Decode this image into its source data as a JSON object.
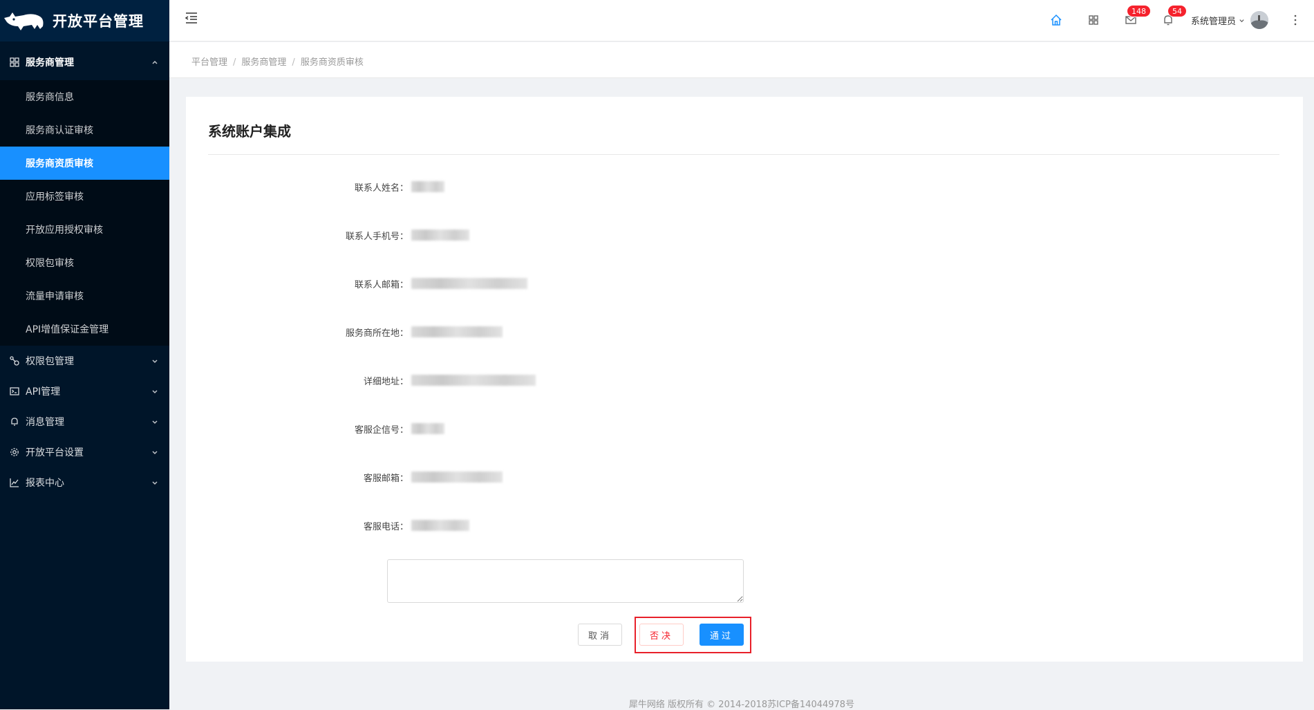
{
  "app": {
    "title": "开放平台管理"
  },
  "sidebar": {
    "groups": [
      {
        "label": "服务商管理",
        "icon": "appstore-icon",
        "expanded": true,
        "items": [
          {
            "label": "服务商信息"
          },
          {
            "label": "服务商认证审核"
          },
          {
            "label": "服务商资质审核",
            "active": true
          },
          {
            "label": "应用标签审核"
          },
          {
            "label": "开放应用授权审核"
          },
          {
            "label": "权限包审核"
          },
          {
            "label": "流量申请审核"
          },
          {
            "label": "API增值保证金管理"
          }
        ]
      },
      {
        "label": "权限包管理",
        "icon": "share-node-icon"
      },
      {
        "label": "API管理",
        "icon": "terminal-icon"
      },
      {
        "label": "消息管理",
        "icon": "bell-icon"
      },
      {
        "label": "开放平台设置",
        "icon": "gear-icon"
      },
      {
        "label": "报表中心",
        "icon": "line-chart-icon"
      }
    ]
  },
  "header": {
    "messages_count": "148",
    "notifications_count": "54",
    "user_name": "系统管理员",
    "accent_color": "#1890ff"
  },
  "breadcrumb": [
    "平台管理",
    "服务商管理",
    "服务商资质审核"
  ],
  "card": {
    "title": "系统账户集成",
    "fields": [
      {
        "label": "联系人姓名："
      },
      {
        "label": "联系人手机号："
      },
      {
        "label": "联系人邮箱："
      },
      {
        "label": "服务商所在地："
      },
      {
        "label": "详细地址："
      },
      {
        "label": "客服企信号："
      },
      {
        "label": "客服邮箱："
      },
      {
        "label": "客服电话："
      }
    ],
    "remark_value": "",
    "buttons": {
      "cancel": "取消",
      "reject": "否决",
      "approve": "通过"
    }
  },
  "footer": {
    "text": "犀牛网络 版权所有 © 2014-2018苏ICP备14044978号"
  }
}
